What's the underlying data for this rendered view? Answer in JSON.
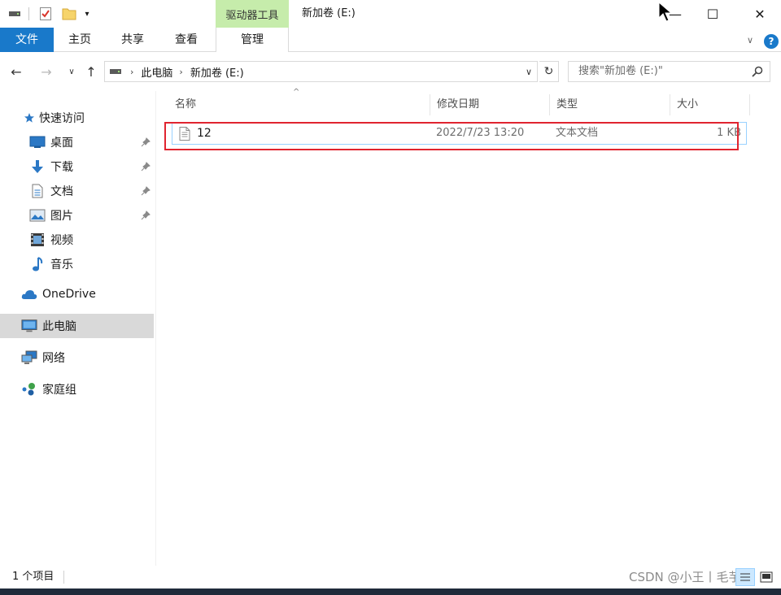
{
  "window": {
    "title": "新加卷 (E:)",
    "context_tab_group": "驱动器工具",
    "controls": {
      "minimize": "—",
      "maximize": "☐",
      "close": "✕"
    }
  },
  "quick_access_toolbar": {
    "items": [
      "drive-icon",
      "properties-icon",
      "new-folder-icon",
      "customize-dropdown"
    ],
    "dropdown_glyph": "▾"
  },
  "ribbon": {
    "tabs": [
      "文件",
      "主页",
      "共享",
      "查看",
      "管理"
    ],
    "active_tab": "文件",
    "collapse_glyph": "∨",
    "help_glyph": "?"
  },
  "navigation": {
    "back_glyph": "←",
    "forward_glyph": "→",
    "recent_glyph": "∨",
    "up_glyph": "↑",
    "breadcrumb": [
      "此电脑",
      "新加卷 (E:)"
    ],
    "breadcrumb_sep": "›",
    "address_dropdown_glyph": "∨",
    "refresh_glyph": "↻",
    "search_placeholder": "搜索\"新加卷 (E:)\""
  },
  "sidebar": {
    "quick_access": {
      "label": "快速访问",
      "icon": "star-icon"
    },
    "items": [
      {
        "label": "桌面",
        "icon": "desktop-icon",
        "pinned": true
      },
      {
        "label": "下载",
        "icon": "download-icon",
        "pinned": true
      },
      {
        "label": "文档",
        "icon": "document-icon",
        "pinned": true
      },
      {
        "label": "图片",
        "icon": "pictures-icon",
        "pinned": true
      },
      {
        "label": "视频",
        "icon": "video-icon",
        "pinned": false
      },
      {
        "label": "音乐",
        "icon": "music-icon",
        "pinned": false
      }
    ],
    "onedrive": {
      "label": "OneDrive",
      "icon": "cloud-icon"
    },
    "this_pc": {
      "label": "此电脑",
      "icon": "computer-icon",
      "selected": true
    },
    "network": {
      "label": "网络",
      "icon": "network-icon"
    },
    "homegroup": {
      "label": "家庭组",
      "icon": "homegroup-icon"
    },
    "pin_glyph": "📌"
  },
  "file_list": {
    "sort_indicator": "^",
    "columns": [
      "名称",
      "修改日期",
      "类型",
      "大小"
    ],
    "rows": [
      {
        "name": "12",
        "modified": "2022/7/23 13:20",
        "type": "文本文档",
        "size": "1 KB",
        "icon": "text-file-icon"
      }
    ]
  },
  "status": {
    "item_count": "1 个项目",
    "watermark": "CSDN @小王丨毛芋"
  },
  "colors": {
    "accent": "#1979ca",
    "context_tab": "#c6ecab",
    "selection_border": "#99d1ff",
    "annotation_red": "#e0242f",
    "sidebar_selected": "#d9d9d9"
  }
}
